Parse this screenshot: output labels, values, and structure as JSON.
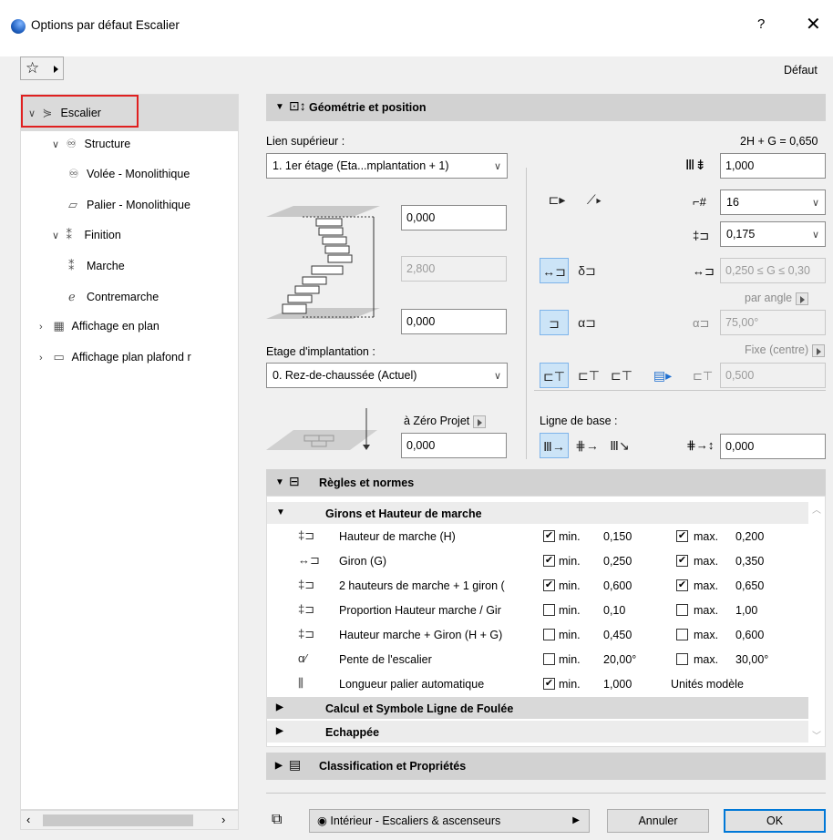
{
  "window": {
    "title": "Options par défaut Escalier",
    "help": "?",
    "close": "✕"
  },
  "toolbar": {
    "favorites_icon": "star-icon",
    "preset_label": "Défaut"
  },
  "tree": {
    "items": [
      {
        "label": "Escalier",
        "icon": "stair-icon"
      },
      {
        "label": "Structure",
        "icon": "structure-icon"
      },
      {
        "label": "Volée - Monolithique",
        "icon": "flight-icon"
      },
      {
        "label": "Palier - Monolithique",
        "icon": "landing-icon"
      },
      {
        "label": "Finition",
        "icon": "finish-icon"
      },
      {
        "label": "Marche",
        "icon": "tread-icon"
      },
      {
        "label": "Contremarche",
        "icon": "riser-icon"
      },
      {
        "label": "Affichage en plan",
        "icon": "floorplan-icon"
      },
      {
        "label": "Affichage plan plafond r",
        "icon": "ceilingplan-icon"
      }
    ]
  },
  "geometry": {
    "header": "Géométrie et position",
    "lien_label": "Lien supérieur :",
    "lien_value": "1. 1er étage (Eta...mplantation + 1)",
    "top_offset": "0,000",
    "height": "2,800",
    "bottom_offset": "0,000",
    "etage_label": "Etage d'implantation :",
    "etage_value": "0. Rez-de-chaussée (Actuel)",
    "zero_label": "à Zéro Projet",
    "zero_value": "0,000",
    "formula": "2H + G = 0,650",
    "run_width": "1,000",
    "riser_count": "16",
    "riser_height": "0,175",
    "tread_range": "0,250 ≤ G ≤ 0,30",
    "par_angle": "par angle",
    "angle": "75,00°",
    "fixe_label": "Fixe (centre)",
    "fixe_value": "0,500",
    "ligne_label": "Ligne de base :",
    "base_offset": "0,000"
  },
  "rules": {
    "header": "Règles et normes",
    "group1": "Girons et Hauteur de marche",
    "rows": [
      {
        "label": "Hauteur de marche (H)",
        "c1": "✔",
        "min": "min.",
        "v1": "0,150",
        "c2": "✔",
        "max": "max.",
        "v2": "0,200"
      },
      {
        "label": "Giron (G)",
        "c1": "✔",
        "min": "min.",
        "v1": "0,250",
        "c2": "✔",
        "max": "max.",
        "v2": "0,350"
      },
      {
        "label": "2 hauteurs de marche + 1 giron (",
        "c1": "✔",
        "min": "min.",
        "v1": "0,600",
        "c2": "✔",
        "max": "max.",
        "v2": "0,650"
      },
      {
        "label": "Proportion Hauteur marche / Gir",
        "c1": "",
        "min": "min.",
        "v1": "0,10",
        "c2": "",
        "max": "max.",
        "v2": "1,00"
      },
      {
        "label": "Hauteur marche + Giron (H + G)",
        "c1": "",
        "min": "min.",
        "v1": "0,450",
        "c2": "",
        "max": "max.",
        "v2": "0,600"
      },
      {
        "label": "Pente de l'escalier",
        "c1": "",
        "min": "min.",
        "v1": "20,00°",
        "c2": "",
        "max": "max.",
        "v2": "30,00°"
      }
    ],
    "last_row": {
      "label": "Longueur palier automatique",
      "c1": "✔",
      "min": "min.",
      "v1": "1,000",
      "units": "Unités modèle"
    },
    "group2": "Calcul et Symbole Ligne de Foulée",
    "group3": "Echappée"
  },
  "classification": {
    "header": "Classification et Propriétés"
  },
  "footer": {
    "layer": "Intérieur - Escaliers & ascenseurs",
    "cancel": "Annuler",
    "ok": "OK"
  }
}
